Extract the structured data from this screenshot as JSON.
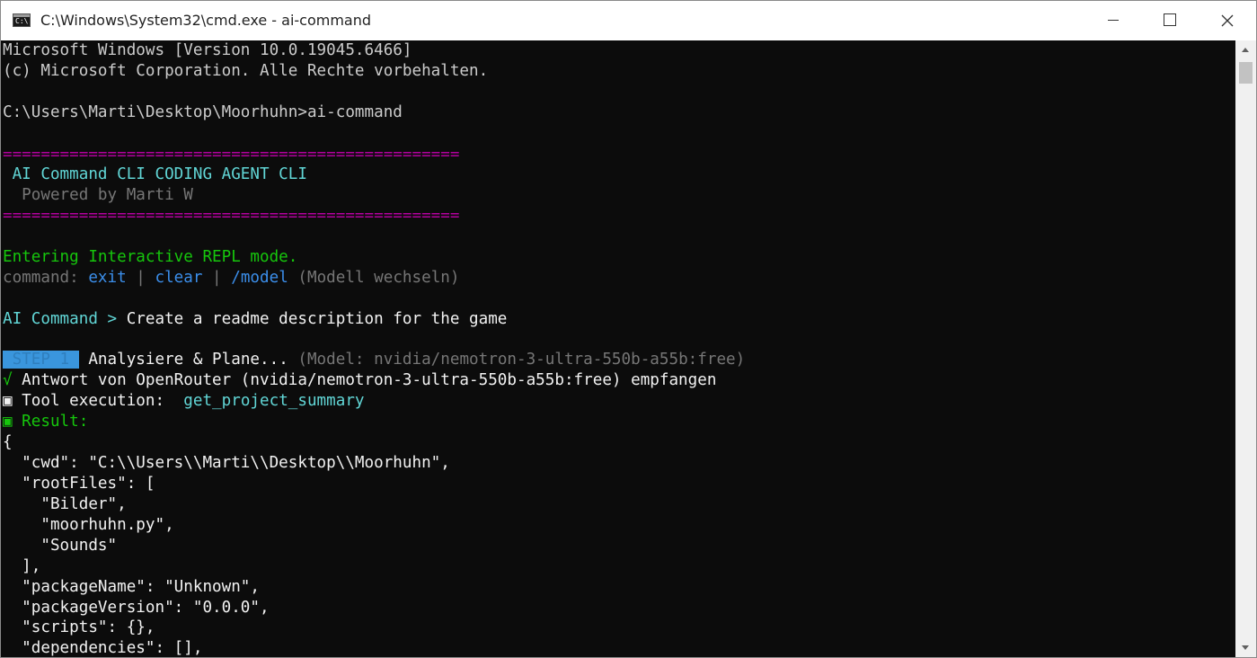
{
  "window": {
    "title": "C:\\Windows\\System32\\cmd.exe - ai-command",
    "icon": "cmd-icon",
    "icon_text": "C:\\",
    "controls": [
      "minimize-icon",
      "maximize-icon",
      "close-icon"
    ]
  },
  "colors": {
    "background": "#0c0c0c",
    "text": "#cccccc",
    "magenta": "#b4009e",
    "cyan": "#61d6d6",
    "green": "#16c60c",
    "gray": "#767676",
    "blue": "#3b8eea",
    "badge": "#3a96dd"
  },
  "console": {
    "header_version": "Microsoft Windows [Version 10.0.19045.6466]",
    "header_copyright": "(c) Microsoft Corporation. Alle Rechte vorbehalten.",
    "prompt_line": "C:\\Users\\Marti\\Desktop\\Moorhuhn>ai-command",
    "banner_rule": "================================================",
    "banner_title": " AI Command CLI CODING AGENT CLI",
    "banner_subtitle": "  Powered by Marti W",
    "repl_mode": "Entering Interactive REPL mode.",
    "commands": {
      "label": "command: ",
      "exit": "exit",
      "sep": " | ",
      "clear": "clear",
      "model": "/model",
      "model_hint": " (Modell wechseln)"
    },
    "user_prompt": {
      "label": "AI Command > ",
      "text": "Create a readme description for the game"
    },
    "step": {
      "badge": " STEP 1 ",
      "title": " Analysiere & Plane... ",
      "model": "(Model: nvidia/nemotron-3-ultra-550b-a55b:free)"
    },
    "response": {
      "mark": "√",
      "text": " Antwort von OpenRouter (nvidia/nemotron-3-ultra-550b-a55b:free) empfangen"
    },
    "tool": {
      "mark": "▣",
      "label": " Tool execution:  ",
      "name": "get_project_summary"
    },
    "result": {
      "mark": "▣",
      "label": " Result:"
    },
    "json_lines": [
      "{",
      "  \"cwd\": \"C:\\\\Users\\\\Marti\\\\Desktop\\\\Moorhuhn\",",
      "  \"rootFiles\": [",
      "    \"Bilder\",",
      "    \"moorhuhn.py\",",
      "    \"Sounds\"",
      "  ],",
      "  \"packageName\": \"Unknown\",",
      "  \"packageVersion\": \"0.0.0\",",
      "  \"scripts\": {},",
      "  \"dependencies\": [],"
    ]
  }
}
